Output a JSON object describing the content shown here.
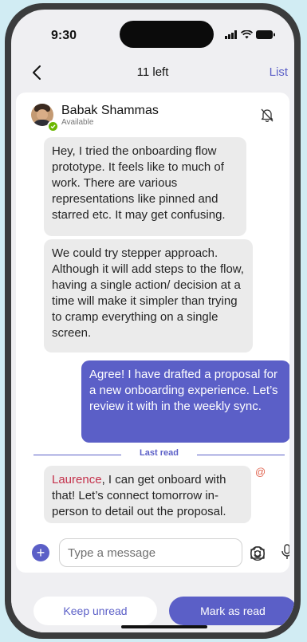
{
  "status_bar": {
    "time": "9:30"
  },
  "nav": {
    "title": "11 left",
    "list_label": "List"
  },
  "chat": {
    "contact_name": "Babak Shammas",
    "presence": "Available",
    "messages": [
      {
        "text": "Hey, I tried the onboarding flow prototype. It feels like to much of work. There are various representations like pinned and starred etc. It may get confusing."
      },
      {
        "text": "We could try stepper approach. Although it will add steps to the flow, having a single action/ decision at a time will make it simpler than trying to cramp everything on a single screen."
      },
      {
        "text": "Agree! I have drafted a proposal for a new onboarding experience. Let’s review it with in the weekly sync."
      }
    ],
    "last_read_label": "Last read",
    "mention_message": {
      "mention": "Laurence",
      "text": ", I can get onboard with that! Let’s connect tomorrow in-person to detail out the proposal.",
      "mention_icon": "@"
    }
  },
  "composer": {
    "placeholder": "Type a message"
  },
  "actions": {
    "keep_unread": "Keep unread",
    "mark_as_read": "Mark as read"
  },
  "colors": {
    "accent": "#5b5fc7",
    "mention": "#c4314b",
    "presence": "#6bb700"
  },
  "icons": [
    "back-chevron-icon",
    "bell-off-icon",
    "add-icon",
    "emoji-icon",
    "camera-icon",
    "microphone-icon",
    "signal-icon",
    "wifi-icon",
    "battery-icon"
  ]
}
